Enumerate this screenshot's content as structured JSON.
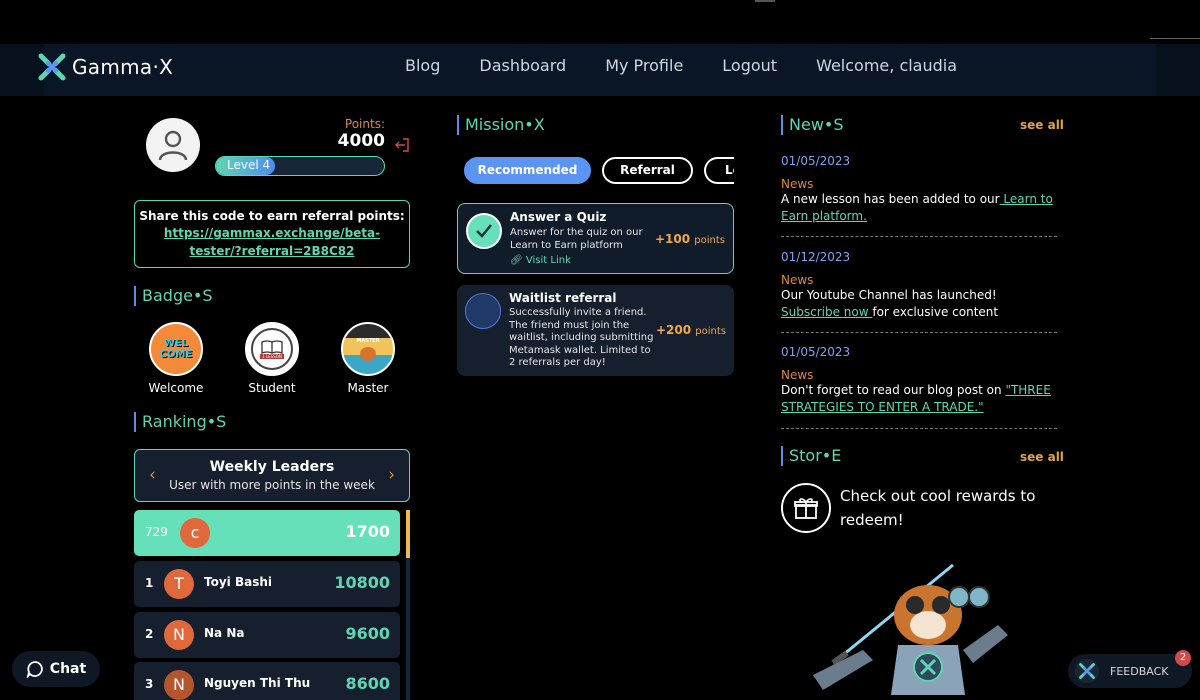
{
  "brand": {
    "name": "Gamma·X"
  },
  "nav": {
    "blog": "Blog",
    "dashboard": "Dashboard",
    "profile": "My Profile",
    "logout": "Logout",
    "welcome": "Welcome, claudia"
  },
  "profile": {
    "points_label": "Points:",
    "points_value": "4000",
    "level_label": "Level 4",
    "level_progress": 0.35
  },
  "referral": {
    "title": "Share this code to earn referral points:",
    "link": "https://gammax.exchange/beta-tester/?referral=2B8C82"
  },
  "badges": {
    "title": "Badge•S",
    "items": [
      {
        "label": "Welcome",
        "art_text": "WEL COME"
      },
      {
        "label": "Student",
        "art_text": "1 LESSON"
      },
      {
        "label": "Master",
        "art_text": "MASTER"
      }
    ]
  },
  "ranking": {
    "title": "Ranking•S",
    "board_title": "Weekly Leaders",
    "board_sub": "User with more points in the week",
    "prev_icon": "‹",
    "next_icon": "›",
    "me": {
      "rank": "729",
      "initial": "c",
      "points": "1700",
      "name": ""
    },
    "rows": [
      {
        "rank": "1",
        "initial": "T",
        "name": "Toyi Bashi",
        "points": "10800"
      },
      {
        "rank": "2",
        "initial": "N",
        "name": "Na Na",
        "points": "9600"
      },
      {
        "rank": "3",
        "initial": "N",
        "name": "Nguyen Thi Thu",
        "points": "8600"
      }
    ]
  },
  "chat": {
    "label": "Chat"
  },
  "mission": {
    "title": "Mission•X",
    "tabs": [
      "Recommended",
      "Referral",
      "Le"
    ],
    "cards": [
      {
        "title": "Answer a Quiz",
        "desc": "Answer for the quiz on our Learn to Earn platform",
        "points": "+100",
        "points_unit": "points",
        "link": "Visit Link"
      },
      {
        "title": "Waitlist referral",
        "desc": "Successfully invite a friend. The friend must join the waitlist, including submitting Metamask wallet. Limited to 2 referrals per day!",
        "points": "+200",
        "points_unit": "points"
      }
    ]
  },
  "news": {
    "title": "New•S",
    "see_all": "see all",
    "items": [
      {
        "date": "01/05/2023",
        "category": "News",
        "text_pre": "A new lesson has been added to our",
        "link": " Learn to Earn platform.",
        "text_post": ""
      },
      {
        "date": "01/12/2023",
        "category": "News",
        "text_pre": "Our Youtube Channel has launched! ",
        "link": "Subscribe now ",
        "text_post": "for exclusive content"
      },
      {
        "date": "01/05/2023",
        "category": "News",
        "text_pre": "Don't forget to read our blog post on ",
        "link": "\"THREE STRATEGIES TO ENTER A TRADE.\"",
        "text_post": ""
      }
    ]
  },
  "store": {
    "title": "Stor•E",
    "see_all": "see all",
    "text": "Check out cool rewards to redeem!"
  },
  "feedback": {
    "label": "FEEDBACK",
    "count": "2"
  },
  "colors": {
    "accent": "#5ed6b4",
    "blue": "#5b95f4",
    "orange": "#e0883a"
  }
}
